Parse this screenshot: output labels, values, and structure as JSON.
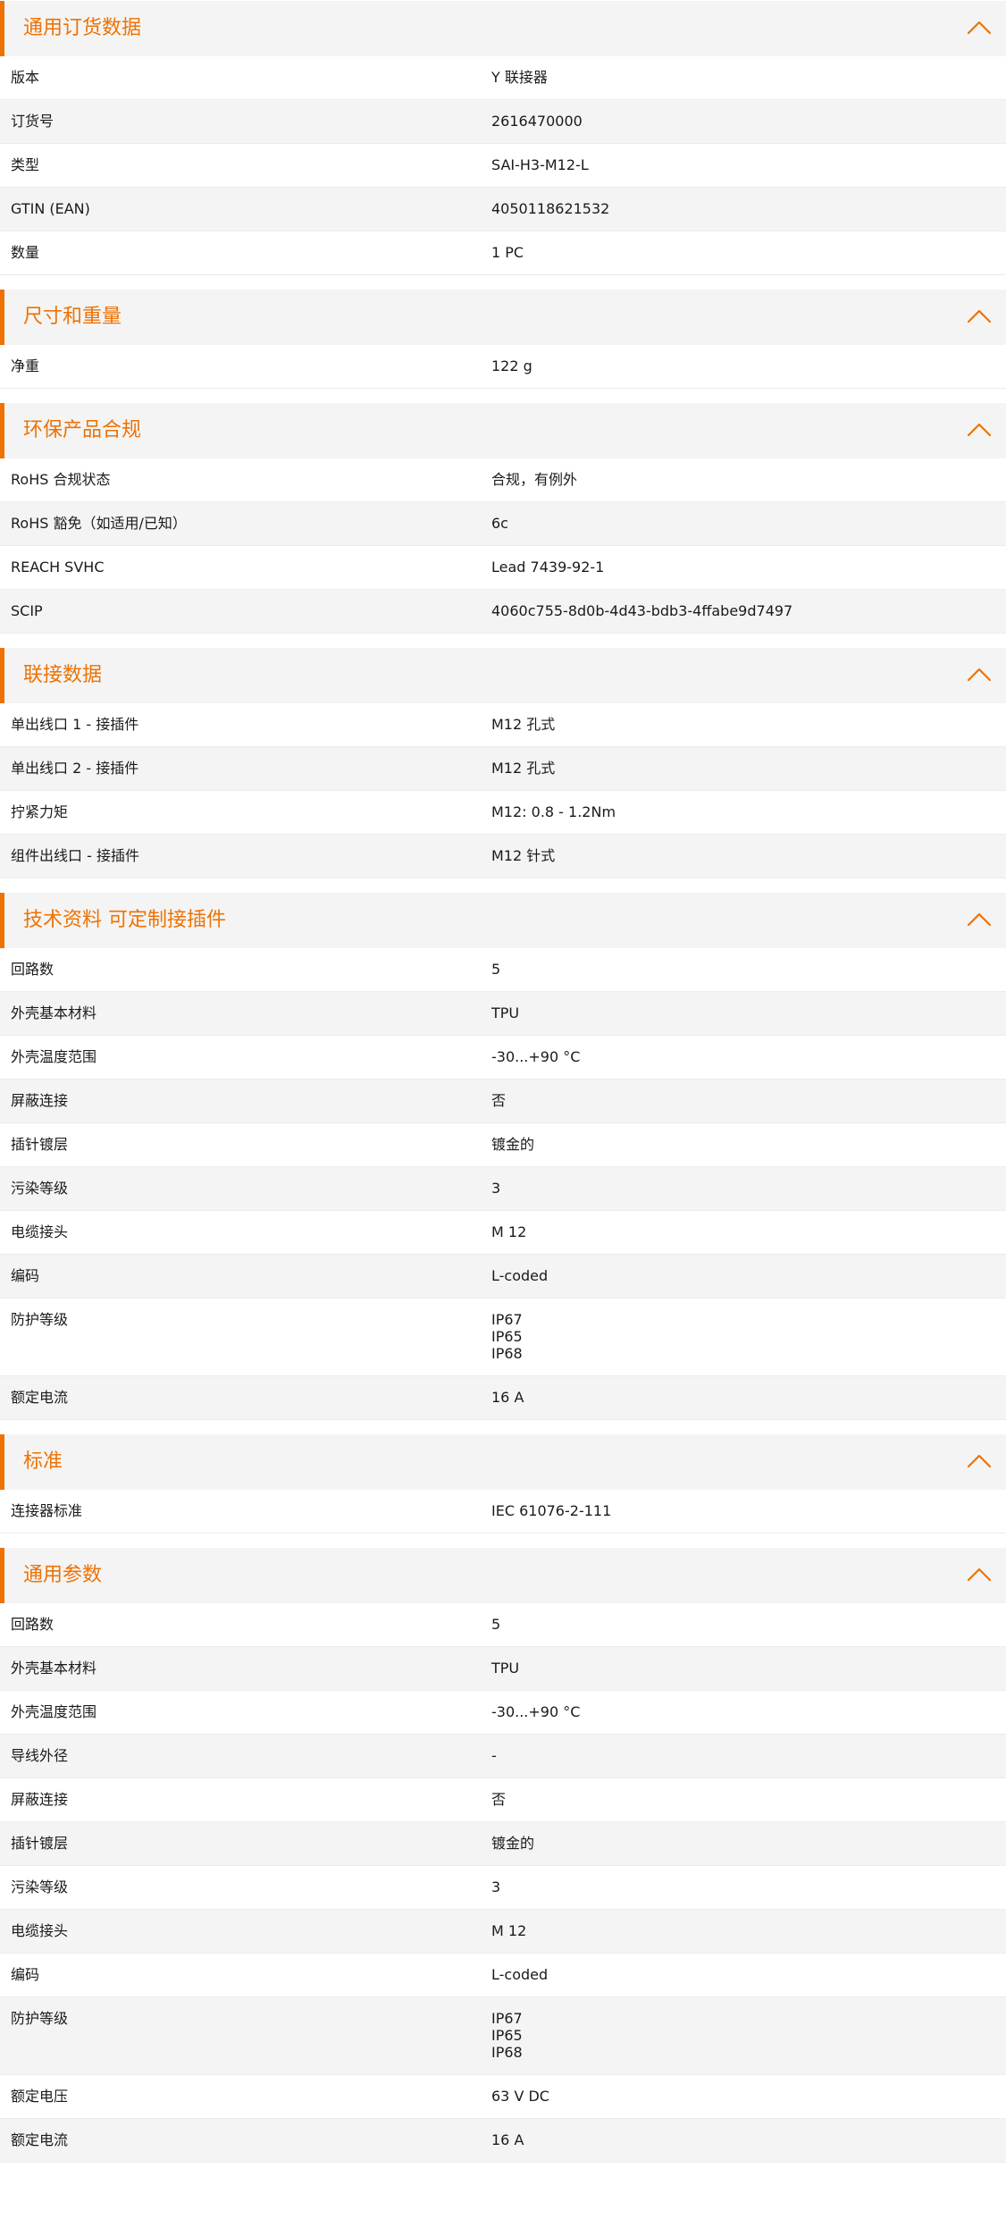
{
  "colors": {
    "accent": "#ee7203",
    "header_bg": "#f4f4f4",
    "row_alt_bg": "#f4f4f4"
  },
  "icons": {
    "collapse": "chevron-up-icon"
  },
  "sections": [
    {
      "title": "通用订货数据",
      "rows": [
        {
          "label": "版本",
          "value": "Y 联接器"
        },
        {
          "label": "订货号",
          "value": "2616470000"
        },
        {
          "label": "类型",
          "value": "SAI-H3-M12-L"
        },
        {
          "label": "GTIN (EAN)",
          "value": "4050118621532"
        },
        {
          "label": "数量",
          "value": "1  PC"
        }
      ]
    },
    {
      "title": "尺寸和重量",
      "rows": [
        {
          "label": "净重",
          "value": "122  g"
        }
      ]
    },
    {
      "title": "环保产品合规",
      "rows": [
        {
          "label": "RoHS 合规状态",
          "value": "合规，有例外"
        },
        {
          "label": "RoHS 豁免（如适用/已知）",
          "value": "6c"
        },
        {
          "label": "REACH SVHC",
          "value": "Lead 7439-92-1"
        },
        {
          "label": "SCIP",
          "value": "4060c755-8d0b-4d43-bdb3-4ffabe9d7497"
        }
      ]
    },
    {
      "title": "联接数据",
      "rows": [
        {
          "label": "单出线口 1 - 接插件",
          "value": "M12 孔式"
        },
        {
          "label": "单出线口 2 - 接插件",
          "value": "M12 孔式"
        },
        {
          "label": "拧紧力矩",
          "value": "M12: 0.8 - 1.2Nm"
        },
        {
          "label": "组件出线口 - 接插件",
          "value": "M12 针式"
        }
      ]
    },
    {
      "title": "技术资料 可定制接插件",
      "rows": [
        {
          "label": "回路数",
          "value": "5"
        },
        {
          "label": "外壳基本材料",
          "value": "TPU"
        },
        {
          "label": "外壳温度范围",
          "value": "-30...+90 °C"
        },
        {
          "label": "屏蔽连接",
          "value": "否"
        },
        {
          "label": "插针镀层",
          "value": "镀金的"
        },
        {
          "label": "污染等级",
          "value": "3"
        },
        {
          "label": "电缆接头",
          "value": "M 12"
        },
        {
          "label": "编码",
          "value": "L-coded"
        },
        {
          "label": "防护等级",
          "value": "IP67\nIP65\nIP68"
        },
        {
          "label": "额定电流",
          "value": "16  A"
        }
      ]
    },
    {
      "title": "标准",
      "rows": [
        {
          "label": "连接器标准",
          "value": "IEC 61076-2-111"
        }
      ]
    },
    {
      "title": "通用参数",
      "rows": [
        {
          "label": "回路数",
          "value": "5"
        },
        {
          "label": "外壳基本材料",
          "value": "TPU"
        },
        {
          "label": "外壳温度范围",
          "value": "-30...+90 °C"
        },
        {
          "label": "导线外径",
          "value": "-"
        },
        {
          "label": "屏蔽连接",
          "value": "否"
        },
        {
          "label": "插针镀层",
          "value": "镀金的"
        },
        {
          "label": "污染等级",
          "value": "3"
        },
        {
          "label": "电缆接头",
          "value": "M 12"
        },
        {
          "label": "编码",
          "value": "L-coded"
        },
        {
          "label": "防护等级",
          "value": "IP67\nIP65\nIP68"
        },
        {
          "label": "额定电压",
          "value": "63 V DC"
        },
        {
          "label": "额定电流",
          "value": "16  A"
        }
      ]
    }
  ]
}
